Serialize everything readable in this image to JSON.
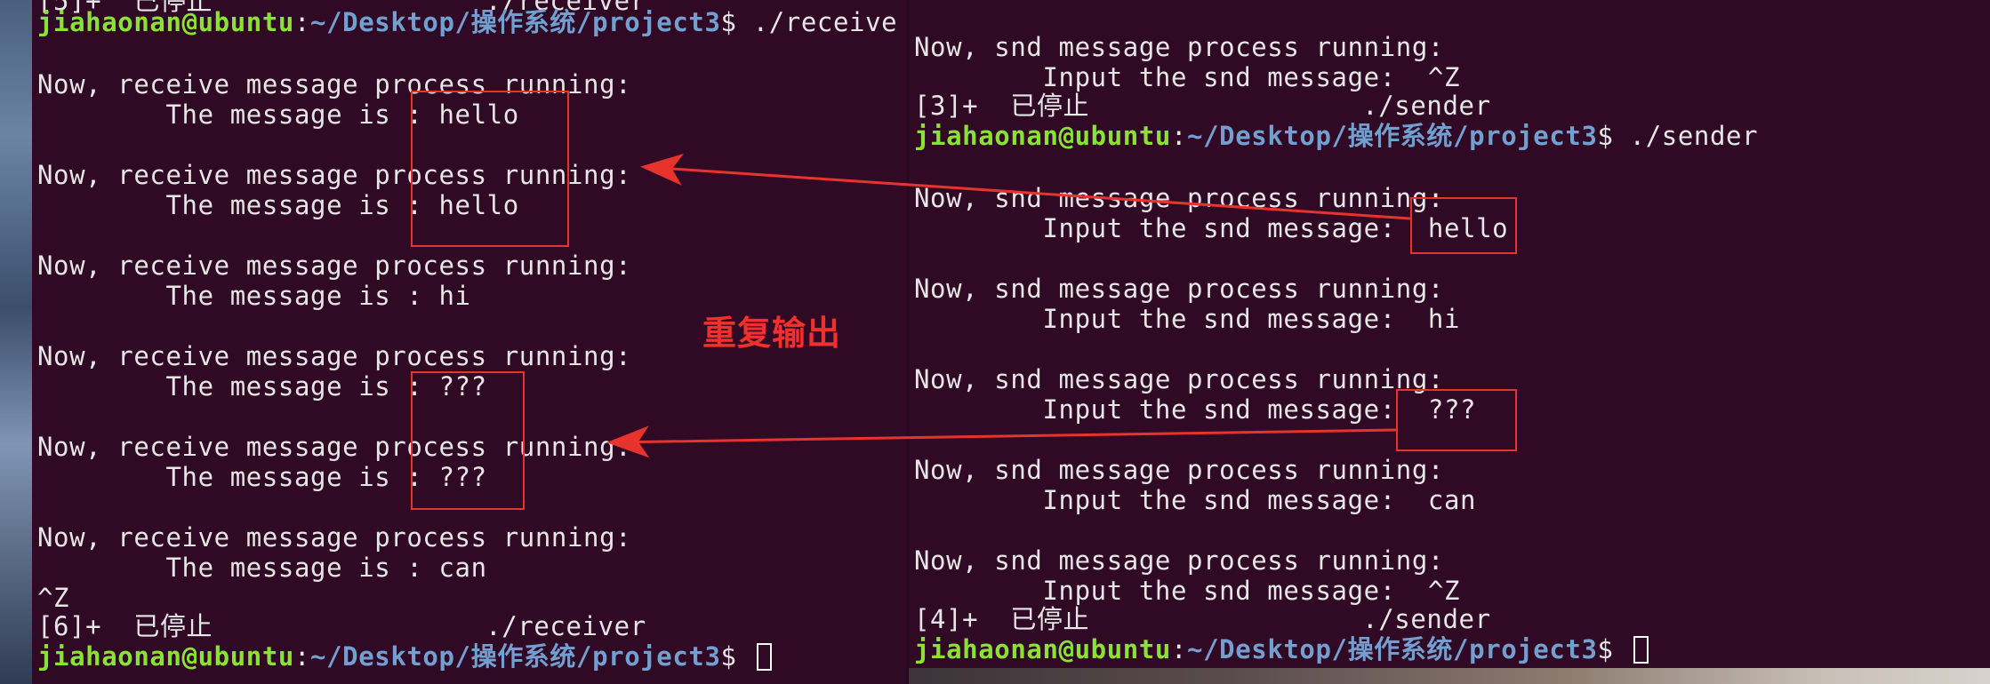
{
  "left_terminal": {
    "lines": [
      {
        "kind": "text",
        "text": "[5]+  已停止                 ./receiver"
      },
      {
        "kind": "prompt",
        "user": "jiahaonan@ubuntu",
        "sep": ":",
        "path": "~/Desktop/操作系统/project3",
        "cmd": "$ ./receive"
      },
      {
        "kind": "text",
        "text": "Now, receive message process running:"
      },
      {
        "kind": "text",
        "text": "        The message is : hello"
      },
      {
        "kind": "text",
        "text": "Now, receive message process running:"
      },
      {
        "kind": "text",
        "text": "        The message is : hello"
      },
      {
        "kind": "text",
        "text": "Now, receive message process running:"
      },
      {
        "kind": "text",
        "text": "        The message is : hi"
      },
      {
        "kind": "text",
        "text": "Now, receive message process running:"
      },
      {
        "kind": "text",
        "text": "        The message is : ???"
      },
      {
        "kind": "text",
        "text": "Now, receive message process running:"
      },
      {
        "kind": "text",
        "text": "        The message is : ???"
      },
      {
        "kind": "text",
        "text": "Now, receive message process running:"
      },
      {
        "kind": "text",
        "text": "        The message is : can"
      },
      {
        "kind": "text",
        "text": "^Z"
      },
      {
        "kind": "text",
        "text": "[6]+  已停止                 ./receiver"
      },
      {
        "kind": "prompt",
        "user": "jiahaonan@ubuntu",
        "sep": ":",
        "path": "~/Desktop/操作系统/project3",
        "cmd": "$ "
      }
    ]
  },
  "right_terminal": {
    "lines": [
      {
        "kind": "text",
        "text": "Now, snd message process running:"
      },
      {
        "kind": "text",
        "text": "        Input the snd message:  ^Z"
      },
      {
        "kind": "text",
        "text": "[3]+  已停止                 ./sender"
      },
      {
        "kind": "prompt",
        "user": "jiahaonan@ubuntu",
        "sep": ":",
        "path": "~/Desktop/操作系统/project3",
        "cmd": "$ ./sender"
      },
      {
        "kind": "text",
        "text": "Now, snd message process running:"
      },
      {
        "kind": "text",
        "text": "        Input the snd message:  hello"
      },
      {
        "kind": "text",
        "text": "Now, snd message process running:"
      },
      {
        "kind": "text",
        "text": "        Input the snd message:  hi"
      },
      {
        "kind": "text",
        "text": "Now, snd message process running:"
      },
      {
        "kind": "text",
        "text": "        Input the snd message:  ???"
      },
      {
        "kind": "text",
        "text": "Now, snd message process running:"
      },
      {
        "kind": "text",
        "text": "        Input the snd message:  can"
      },
      {
        "kind": "text",
        "text": "Now, snd message process running:"
      },
      {
        "kind": "text",
        "text": "        Input the snd message:  ^Z"
      },
      {
        "kind": "text",
        "text": "[4]+  已停止                 ./sender"
      },
      {
        "kind": "prompt",
        "user": "jiahaonan@ubuntu",
        "sep": ":",
        "path": "~/Desktop/操作系统/project3",
        "cmd": "$ "
      }
    ]
  },
  "annotation": {
    "label": "重复输出",
    "color": "#e8322c"
  },
  "colors": {
    "terminal_bg": "#300a24",
    "user": "#8ae234",
    "path": "#729fcf",
    "text": "#e6e6e6"
  }
}
